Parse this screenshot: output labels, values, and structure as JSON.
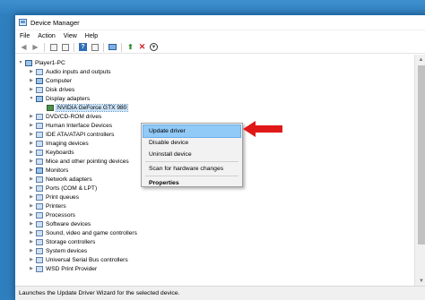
{
  "window": {
    "title": "Device Manager"
  },
  "menubar": {
    "items": [
      "File",
      "Action",
      "View",
      "Help"
    ]
  },
  "tree": {
    "root": "Player1-PC",
    "categories": [
      "Audio inputs and outputs",
      "Computer",
      "Disk drives",
      "Display adapters",
      "NVIDIA GeForce GTX 980",
      "DVD/CD-ROM drives",
      "Human Interface Devices",
      "IDE ATA/ATAPI controllers",
      "Imaging devices",
      "Keyboards",
      "Mice and other pointing devices",
      "Monitors",
      "Network adapters",
      "Ports (COM & LPT)",
      "Print queues",
      "Printers",
      "Processors",
      "Software devices",
      "Sound, video and game controllers",
      "Storage controllers",
      "System devices",
      "Universal Serial Bus controllers",
      "WSD Print Provider"
    ]
  },
  "context_menu": {
    "items": [
      "Update driver",
      "Disable device",
      "Uninstall device",
      "Scan for hardware changes",
      "Properties"
    ]
  },
  "statusbar": {
    "text": "Launches the Update Driver Wizard for the selected device."
  },
  "colors": {
    "accent_arrow": "#e01818",
    "menu_hover": "#91c9f7",
    "desktop": "#2f7fbf"
  }
}
